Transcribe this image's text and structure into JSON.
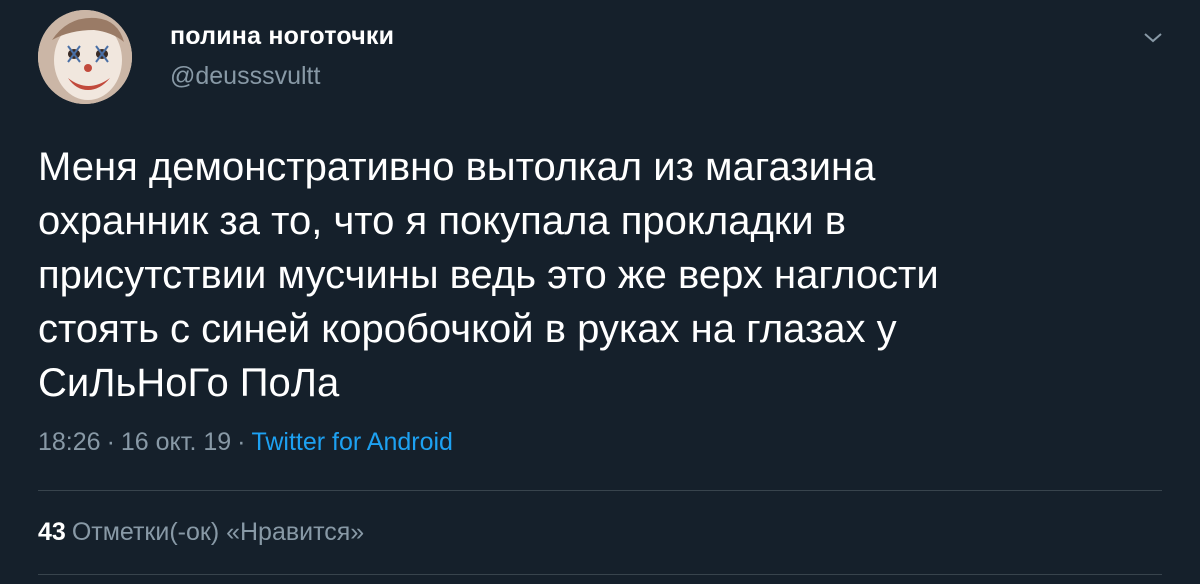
{
  "author": {
    "display_name": "полина ноготочки",
    "handle": "@deusssvultt",
    "avatar_icon": "clown-face-avatar"
  },
  "menu_icon": "chevron-down-icon",
  "tweet": {
    "text": "Меня демонстративно вытолкал из магазина\nохранник за то, что я покупала прокладки в\nприсутствии мусчины ведь это же  верх наглости\nстоять с синей коробочкой в руках на глазах у\nСиЛьНоГо ПоЛа"
  },
  "meta": {
    "time": "18:26",
    "separator": "·",
    "date": "16 окт. 19",
    "source": "Twitter for Android"
  },
  "stats": {
    "likes_count": "43",
    "likes_label": "Отметки(-ок) «Нравится»"
  },
  "colors": {
    "background": "#15202b",
    "text_primary": "#ffffff",
    "text_secondary": "#8899a6",
    "accent": "#1da1f2",
    "divider": "#38444d"
  }
}
